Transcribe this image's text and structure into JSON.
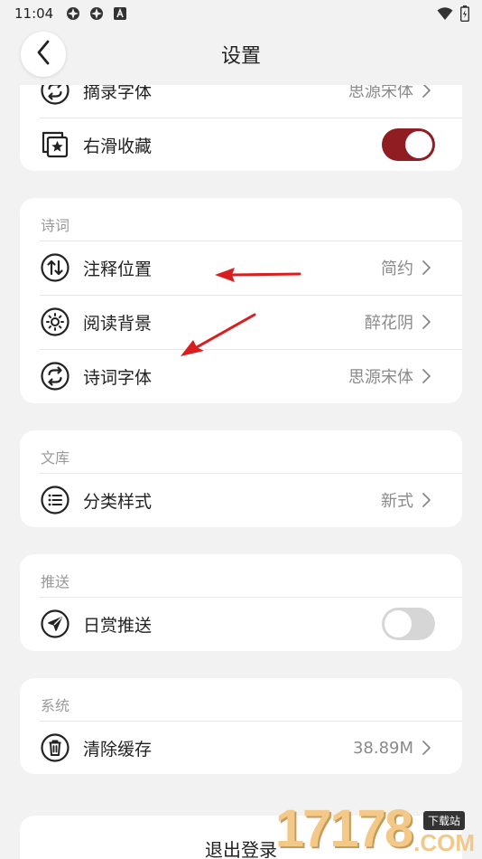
{
  "status_bar": {
    "time": "11:04"
  },
  "header": {
    "title": "设置"
  },
  "card_top": {
    "rows": [
      {
        "label": "摘录字体",
        "value": "思源宋体",
        "icon": "swap-circle-icon"
      },
      {
        "label": "右滑收藏",
        "toggle": true,
        "icon": "star-square-icon"
      }
    ]
  },
  "card_poem": {
    "label": "诗词",
    "rows": [
      {
        "label": "注释位置",
        "value": "简约",
        "icon": "sort-arrows-icon"
      },
      {
        "label": "阅读背景",
        "value": "醉花阴",
        "icon": "sun-icon"
      },
      {
        "label": "诗词字体",
        "value": "思源宋体",
        "icon": "swap-circle-icon"
      }
    ]
  },
  "card_library": {
    "label": "文库",
    "rows": [
      {
        "label": "分类样式",
        "value": "新式",
        "icon": "list-icon"
      }
    ]
  },
  "card_push": {
    "label": "推送",
    "rows": [
      {
        "label": "日赏推送",
        "toggle": false,
        "icon": "paper-plane-icon"
      }
    ]
  },
  "card_system": {
    "label": "系统",
    "rows": [
      {
        "label": "清除缓存",
        "value": "38.89M",
        "icon": "trash-icon"
      }
    ]
  },
  "logout": {
    "label": "退出登录"
  },
  "watermark": {
    "number": "17178",
    "tag": "下载站",
    "suffix": ".COM"
  },
  "colors": {
    "accent": "#8f1d22",
    "arrow": "#d81e1e",
    "background": "#f2f2f2"
  }
}
